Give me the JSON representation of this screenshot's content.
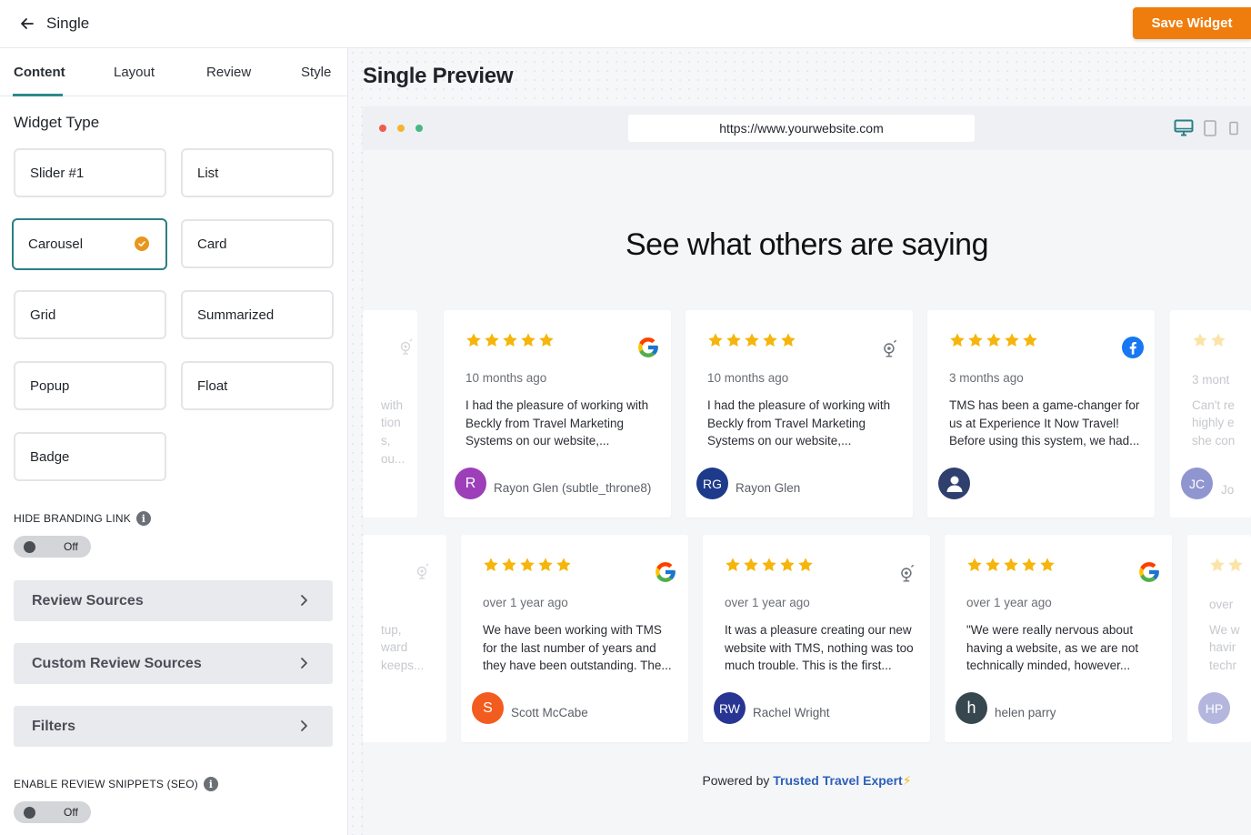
{
  "header": {
    "title": "Single",
    "save_label": "Save Widget"
  },
  "sidebar": {
    "tabs": [
      "Content",
      "Layout",
      "Review",
      "Style"
    ],
    "widget_type_title": "Widget Type",
    "widget_types": [
      "Slider #1",
      "List",
      "Carousel",
      "Card",
      "Grid",
      "Summarized",
      "Popup",
      "Float",
      "Badge"
    ],
    "selected_widget_type": "Carousel",
    "hide_branding_label": "HIDE BRANDING LINK",
    "hide_branding_value": "Off",
    "accordions": [
      "Review Sources",
      "Custom Review Sources",
      "Filters"
    ],
    "seo_label": "ENABLE REVIEW SNIPPETS (SEO)",
    "seo_value": "Off"
  },
  "preview": {
    "title": "Single Preview",
    "url": "https://www.yourwebsite.com",
    "headline": "See what others are saying",
    "powered_prefix": "Powered by",
    "powered_brand": "Trusted Travel Expert",
    "powered_bolt": "⚡",
    "colors": {
      "accent": "#ef7d0e",
      "teal": "#2a7f86",
      "star": "#f5b50a",
      "brand_link": "#2c5fb9"
    },
    "row1": [
      {
        "date": "10 months ago",
        "text": "I had the pleasure of working with Beckly from Travel Marketing Systems on our website,...",
        "avatar": "R",
        "avatar_color": "#9c3fb8",
        "name": "Rayon Glen (subtle_throne8)",
        "source": "google-icon"
      },
      {
        "date": "10 months ago",
        "text": "I had the pleasure of working with Beckly from Travel Marketing Systems on our website,...",
        "avatar": "RG",
        "avatar_color": "#1e3a8a",
        "name": "Rayon Glen",
        "source": "tripadvisor-icon"
      },
      {
        "date": "3 months ago",
        "text": "TMS has been a game-changer for us at Experience It Now Travel! Before using this system, we had...",
        "avatar": "",
        "avatar_color": "#2f3f6e",
        "name": "",
        "source": "facebook-icon"
      }
    ],
    "row2": [
      {
        "date": "over 1 year ago",
        "text": "We have been working with TMS for the last number of years and they have been outstanding. The...",
        "avatar": "S",
        "avatar_color": "#f25c1e",
        "name": "Scott McCabe",
        "source": "google-icon"
      },
      {
        "date": "over 1 year ago",
        "text": "It was a pleasure creating our new website with TMS, nothing was too much trouble. This is the first...",
        "avatar": "RW",
        "avatar_color": "#283593",
        "name": "Rachel Wright",
        "source": "tripadvisor-icon"
      },
      {
        "date": "over 1 year ago",
        "text": "\"We were really nervous about having a website, as we are not technically minded, however...",
        "avatar": "h",
        "avatar_color": "#37474f",
        "name": "helen parry",
        "source": "google-icon"
      }
    ],
    "partial_left_row1": [
      "with",
      "tion",
      "s, ou..."
    ],
    "partial_left_row2": [
      "tup,",
      "ward",
      "keeps..."
    ],
    "partial_right_row1": {
      "date": "3 mont",
      "lines": [
        "Can't re",
        "highly e",
        "she con"
      ],
      "avatar": "JC",
      "name": "Jo"
    },
    "partial_right_row2": {
      "date": "over",
      "lines": [
        "We w",
        "havir",
        "techr"
      ],
      "avatar": "HP"
    }
  }
}
